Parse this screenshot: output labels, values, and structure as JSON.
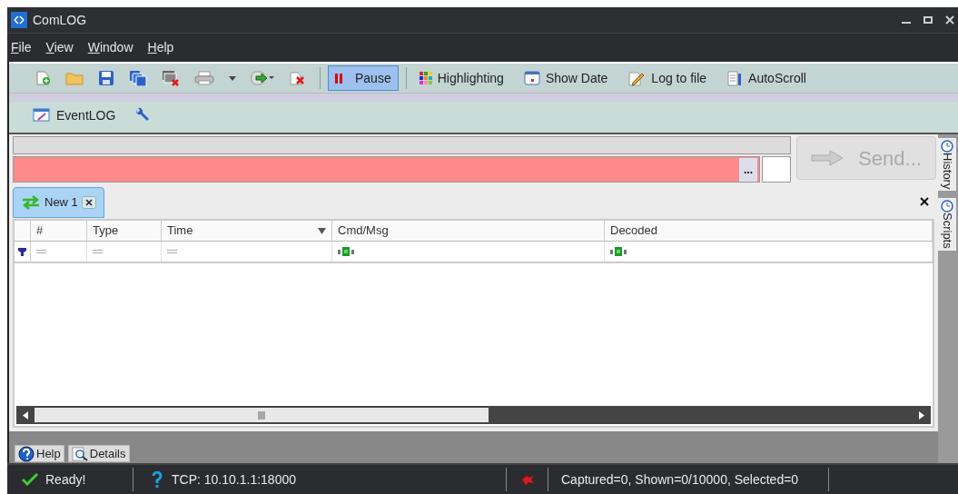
{
  "window": {
    "title": "ComLOG"
  },
  "menu": [
    "File",
    "View",
    "Window",
    "Help"
  ],
  "toolbar_buttons": [
    {
      "label": "Pause",
      "selected": true
    },
    {
      "label": "Highlighting",
      "selected": false
    },
    {
      "label": "Show Date",
      "selected": false
    },
    {
      "label": "Log to file",
      "selected": false
    },
    {
      "label": "AutoScroll",
      "selected": false
    }
  ],
  "second_toolbar": {
    "label": "EventLOG"
  },
  "input": {
    "invalid": true,
    "browse": "...",
    "send": {
      "label": "Send...",
      "disabled": true
    }
  },
  "side_tabs": [
    "History",
    "Scripts"
  ],
  "doc_tabs": [
    {
      "label": "New 1",
      "selected": true
    }
  ],
  "grid": {
    "columns": [
      "#",
      "Type",
      "Time",
      "Cmd/Msg",
      "Decoded"
    ]
  },
  "bottom_tabs": [
    "Help",
    "Details"
  ],
  "status_bar": {
    "state": "Ready!",
    "connection": "TCP: 10.10.1.1:18000",
    "counts": "Captured=0, Shown=0/10000, Selected=0"
  }
}
